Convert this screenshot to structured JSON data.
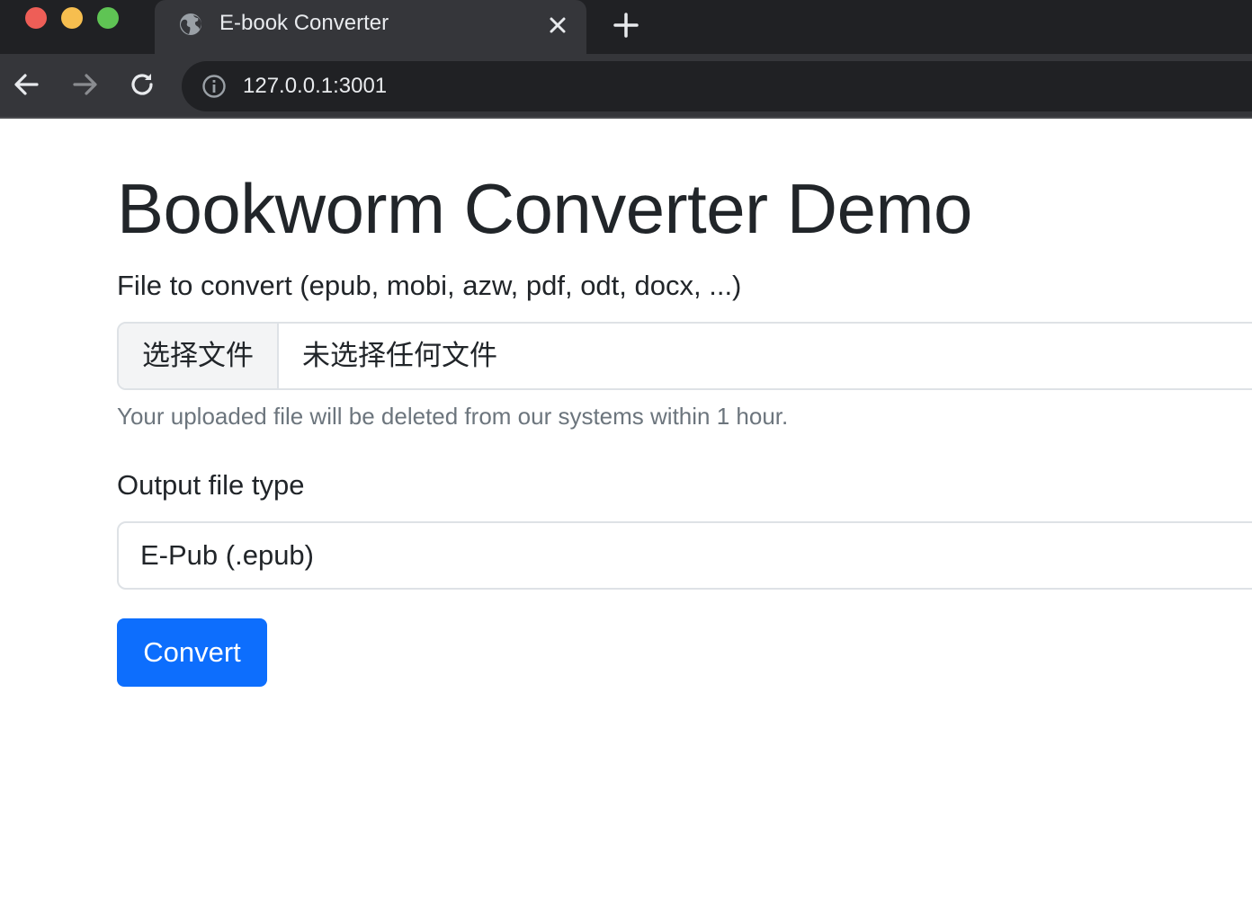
{
  "browser": {
    "tab": {
      "title": "E-book Converter"
    },
    "address_bar": {
      "url": "127.0.0.1:3001"
    },
    "icons": {
      "favicon": "globe-icon",
      "close": "close-icon",
      "new_tab": "plus-icon",
      "back": "arrow-left-icon",
      "forward": "arrow-right-icon",
      "reload": "reload-icon",
      "site_info": "info-icon"
    },
    "colors": {
      "tabstrip_bg": "#202124",
      "toolbar_bg": "#35363a",
      "traffic_red": "#ee5e57",
      "traffic_yellow": "#f6be4f",
      "traffic_green": "#5fc454"
    }
  },
  "page": {
    "title": "Bookworm Converter Demo",
    "file_field": {
      "label": "File to convert (epub, mobi, azw, pdf, odt, docx, ...)",
      "choose_button_label": "选择文件",
      "status_text": "未选择任何文件",
      "help_text": "Your uploaded file will be deleted from our systems within 1 hour."
    },
    "output_field": {
      "label": "Output file type",
      "selected_value": "E-Pub (.epub)"
    },
    "submit": {
      "label": "Convert",
      "color": "#0d6efd"
    }
  }
}
